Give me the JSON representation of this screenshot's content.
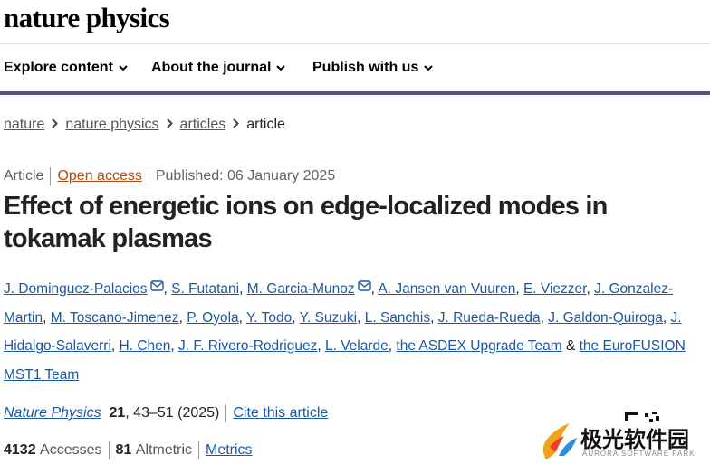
{
  "site": {
    "logo": "nature physics"
  },
  "nav": {
    "items": [
      {
        "label": "Explore content"
      },
      {
        "label": "About the journal"
      },
      {
        "label": "Publish with us"
      }
    ]
  },
  "breadcrumb": [
    "nature",
    "nature physics",
    "articles",
    "article"
  ],
  "article_meta": {
    "type": "Article",
    "access": "Open access",
    "published": "Published: 06 January 2025"
  },
  "title": "Effect of energetic ions on edge-localized modes in tokamak plasmas",
  "authors": [
    "J. Dominguez-Palacios",
    "S. Futatani",
    "M. Garcia-Munoz",
    "A. Jansen van Vuuren",
    "E. Viezzer",
    "J. Gonzalez-Martin",
    "M. Toscano-Jimenez",
    "P. Oyola",
    "Y. Todo",
    "Y. Suzuki",
    "L. Sanchis",
    "J. Rueda-Rueda",
    "J. Galdon-Quiroga",
    "J. Hidalgo-Salaverri",
    "H. Chen",
    "J. F. Rivero-Rodriguez",
    "L. Velarde",
    "the ASDEX Upgrade Team",
    "the EuroFUSION MST1 Team"
  ],
  "author_and": "&",
  "citation": {
    "journal": "Nature Physics",
    "volume": "21",
    "pages": ", 43–51 (2025)",
    "cite_link": "Cite this article"
  },
  "metrics": {
    "accesses_value": "4132",
    "accesses_label": "Accesses",
    "altmetric_value": "81",
    "altmetric_label": "Altmetric",
    "metrics_link": "Metrics"
  },
  "watermark": {
    "text": "极光软件园",
    "sub": "AURORA SOFTWARE PARK"
  },
  "colors": {
    "link": "#1d56a3",
    "open_access": "#b54c0c",
    "nav_bar": "#545488"
  }
}
